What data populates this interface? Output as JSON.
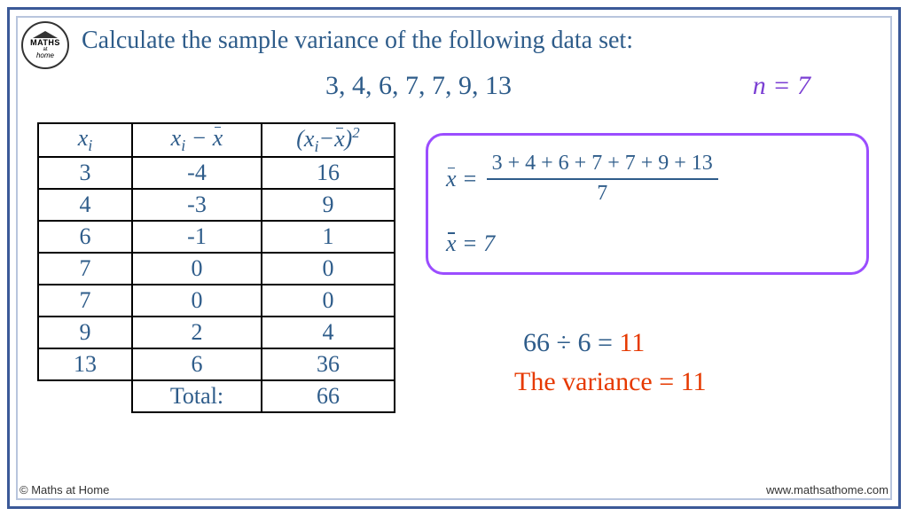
{
  "title": "Calculate the sample variance of the following data set:",
  "data_set": "3, 4, 6, 7, 7, 9, 13",
  "n_label": "n = 7",
  "table": {
    "headers": {
      "xi": "x",
      "dev": "x  − x̄",
      "sq": "(x −x̄)"
    },
    "rows": [
      {
        "xi": "3",
        "dev": "-4",
        "sq": "16"
      },
      {
        "xi": "4",
        "dev": "-3",
        "sq": "9"
      },
      {
        "xi": "6",
        "dev": "-1",
        "sq": "1"
      },
      {
        "xi": "7",
        "dev": "0",
        "sq": "0"
      },
      {
        "xi": "7",
        "dev": "0",
        "sq": "0"
      },
      {
        "xi": "9",
        "dev": "2",
        "sq": "4"
      },
      {
        "xi": "13",
        "dev": "6",
        "sq": "36"
      }
    ],
    "total_label": "Total:",
    "total_value": "66"
  },
  "mean": {
    "lhs": "x̄ =",
    "numerator": "3 + 4 + 6 + 7 + 7 + 9 + 13",
    "denominator": "7",
    "result": "x̄ = 7"
  },
  "calc": {
    "expr": "66 ÷ 6 =",
    "result": "11"
  },
  "variance_text": "The variance = 11",
  "logo": {
    "l1": "MATHS",
    "l2": "at",
    "l3": "home"
  },
  "copyright": "© Maths at Home",
  "website": "www.mathsathome.com"
}
